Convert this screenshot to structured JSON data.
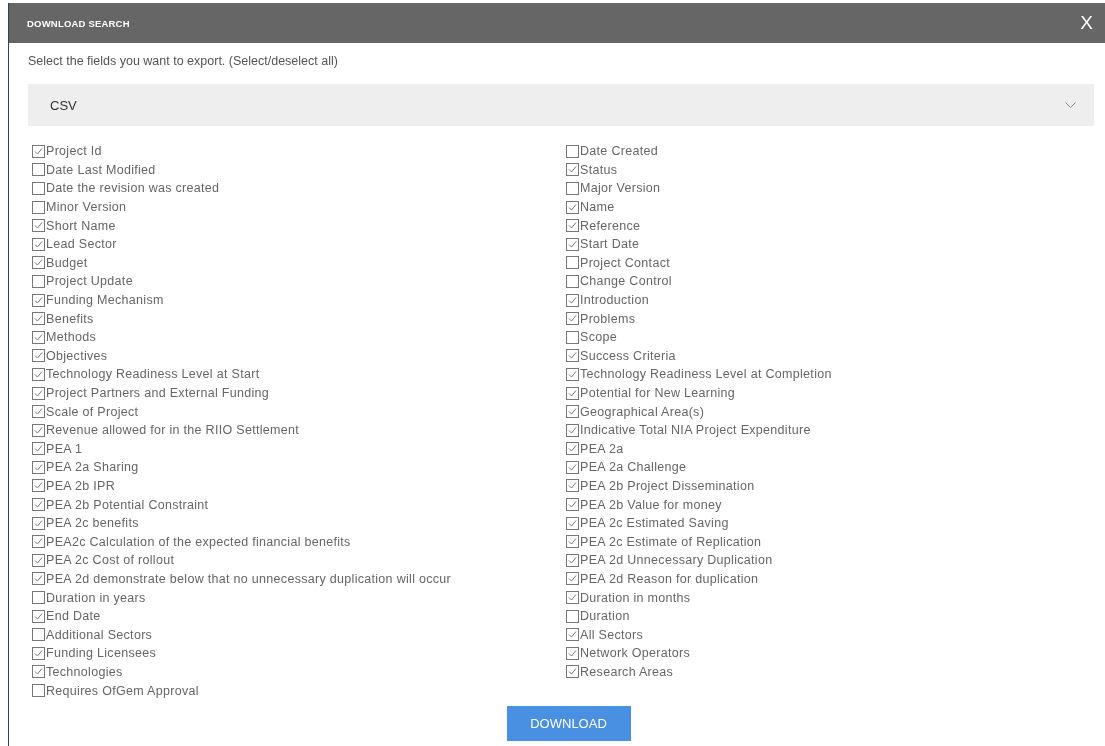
{
  "dialog": {
    "title": "DOWNLOAD SEARCH",
    "close": "X"
  },
  "instruction": "Select the fields you want to export. (Select/deselect all)",
  "format_select": {
    "value": "CSV"
  },
  "columns": [
    [
      {
        "label": "Project Id",
        "checked": true
      },
      {
        "label": "Date Last Modified",
        "checked": false
      },
      {
        "label": "Date the revision was created",
        "checked": false
      },
      {
        "label": "Minor Version",
        "checked": false
      },
      {
        "label": "Short Name",
        "checked": true
      },
      {
        "label": "Lead Sector",
        "checked": true
      },
      {
        "label": "Budget",
        "checked": true
      },
      {
        "label": "Project Update",
        "checked": false
      },
      {
        "label": "Funding Mechanism",
        "checked": true
      },
      {
        "label": "Benefits",
        "checked": true
      },
      {
        "label": "Methods",
        "checked": true
      },
      {
        "label": "Objectives",
        "checked": true
      },
      {
        "label": "Technology Readiness Level at Start",
        "checked": true
      },
      {
        "label": "Project Partners and External Funding",
        "checked": true
      },
      {
        "label": "Scale of Project",
        "checked": true
      },
      {
        "label": "Revenue allowed for in the RIIO Settlement",
        "checked": true
      },
      {
        "label": "PEA 1",
        "checked": true
      },
      {
        "label": "PEA 2a Sharing",
        "checked": true
      },
      {
        "label": "PEA 2b IPR",
        "checked": true
      },
      {
        "label": "PEA 2b Potential Constraint",
        "checked": true
      },
      {
        "label": "PEA 2c benefits",
        "checked": true
      },
      {
        "label": "PEA2c Calculation of the expected financial benefits",
        "checked": true
      },
      {
        "label": "PEA 2c Cost of rollout",
        "checked": true
      },
      {
        "label": "PEA 2d demonstrate below that no unnecessary duplication will occur",
        "checked": true
      },
      {
        "label": "Duration in years",
        "checked": false
      },
      {
        "label": "End Date",
        "checked": true
      },
      {
        "label": "Additional Sectors",
        "checked": false
      },
      {
        "label": "Funding Licensees",
        "checked": true
      },
      {
        "label": "Technologies",
        "checked": true
      },
      {
        "label": "Requires OfGem Approval",
        "checked": false
      }
    ],
    [
      {
        "label": "Date Created",
        "checked": false
      },
      {
        "label": "Status",
        "checked": true
      },
      {
        "label": "Major Version",
        "checked": false
      },
      {
        "label": "Name",
        "checked": true
      },
      {
        "label": "Reference",
        "checked": true
      },
      {
        "label": "Start Date",
        "checked": true
      },
      {
        "label": "Project Contact",
        "checked": false
      },
      {
        "label": "Change Control",
        "checked": false
      },
      {
        "label": "Introduction",
        "checked": true
      },
      {
        "label": "Problems",
        "checked": true
      },
      {
        "label": "Scope",
        "checked": false
      },
      {
        "label": "Success Criteria",
        "checked": true
      },
      {
        "label": "Technology Readiness Level at Completion",
        "checked": true
      },
      {
        "label": "Potential for New Learning",
        "checked": true
      },
      {
        "label": "Geographical Area(s)",
        "checked": true
      },
      {
        "label": "Indicative Total NIA Project Expenditure",
        "checked": true
      },
      {
        "label": "PEA 2a",
        "checked": true
      },
      {
        "label": "PEA 2a Challenge",
        "checked": true
      },
      {
        "label": "PEA 2b Project Dissemination",
        "checked": true
      },
      {
        "label": "PEA 2b Value for money",
        "checked": true
      },
      {
        "label": "PEA 2c Estimated Saving",
        "checked": true
      },
      {
        "label": "PEA 2c Estimate of Replication",
        "checked": true
      },
      {
        "label": "PEA 2d Unnecessary Duplication",
        "checked": true
      },
      {
        "label": "PEA 2d Reason for duplication",
        "checked": true
      },
      {
        "label": "Duration in months",
        "checked": true
      },
      {
        "label": "Duration",
        "checked": false
      },
      {
        "label": "All Sectors",
        "checked": true
      },
      {
        "label": "Network Operators",
        "checked": true
      },
      {
        "label": "Research Areas",
        "checked": true
      }
    ]
  ],
  "download_button": "DOWNLOAD"
}
